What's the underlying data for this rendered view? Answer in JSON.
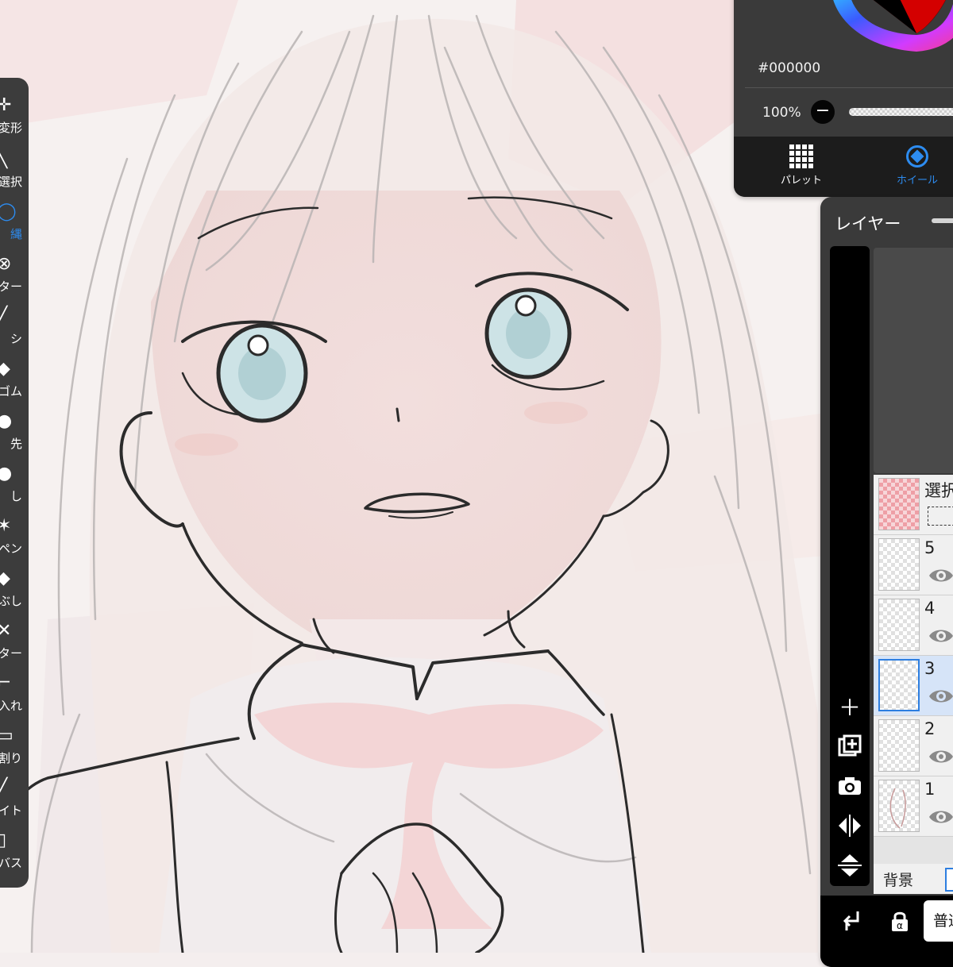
{
  "toolbar": {
    "tools": [
      {
        "label": "変形",
        "icon": "move-arrows-icon"
      },
      {
        "label": "選択",
        "icon": "wand-icon"
      },
      {
        "label": "投縄",
        "icon": "lasso-icon"
      },
      {
        "label": "フィルター",
        "icon": "filter-icon"
      },
      {
        "label": "ブラシ",
        "icon": "brush-icon"
      },
      {
        "label": "消しゴム",
        "icon": "eraser-icon"
      },
      {
        "label": "指先",
        "icon": "finger-icon"
      },
      {
        "label": "ぼかし",
        "icon": "blur-drop-icon"
      },
      {
        "label": "ペン",
        "icon": "pen-icon"
      },
      {
        "label": "塗りつぶし",
        "icon": "fill-bucket-icon"
      },
      {
        "label": "テキスター",
        "icon": "text-icon"
      },
      {
        "label": "コマ入れ",
        "icon": "frame-insert-icon"
      },
      {
        "label": "コマ割り",
        "icon": "frame-divide-icon"
      },
      {
        "label": "スポイト",
        "icon": "eyedropper-icon"
      },
      {
        "label": "キャンバス",
        "icon": "canvas-icon"
      }
    ],
    "visible_labels": [
      "変形",
      "選択",
      "縄",
      "ター",
      "シ",
      "ゴム",
      "先",
      "し",
      "ペン",
      "ぶし",
      "ター",
      "入れ",
      "割り",
      "イト",
      "バス"
    ],
    "active_index": 2
  },
  "color_panel": {
    "hex": "#000000",
    "opacity": "100%",
    "selected_color": "#000000",
    "tabs": [
      {
        "label": "パレット",
        "icon": "palette-grid-icon"
      },
      {
        "label": "ホイール",
        "icon": "color-wheel-icon"
      }
    ],
    "active_tab": 1
  },
  "layer_panel": {
    "title": "レイヤー",
    "layers": [
      {
        "name": "選択",
        "type": "selection"
      },
      {
        "name": "5",
        "visible": true
      },
      {
        "name": "4",
        "visible": true
      },
      {
        "name": "3",
        "visible": true,
        "active": true
      },
      {
        "name": "2",
        "visible": true
      },
      {
        "name": "1",
        "visible": true
      }
    ],
    "background_label": "背景",
    "background_color": "#ffffff",
    "blend_mode": "普通",
    "accent_color": "#2d7ee0"
  }
}
